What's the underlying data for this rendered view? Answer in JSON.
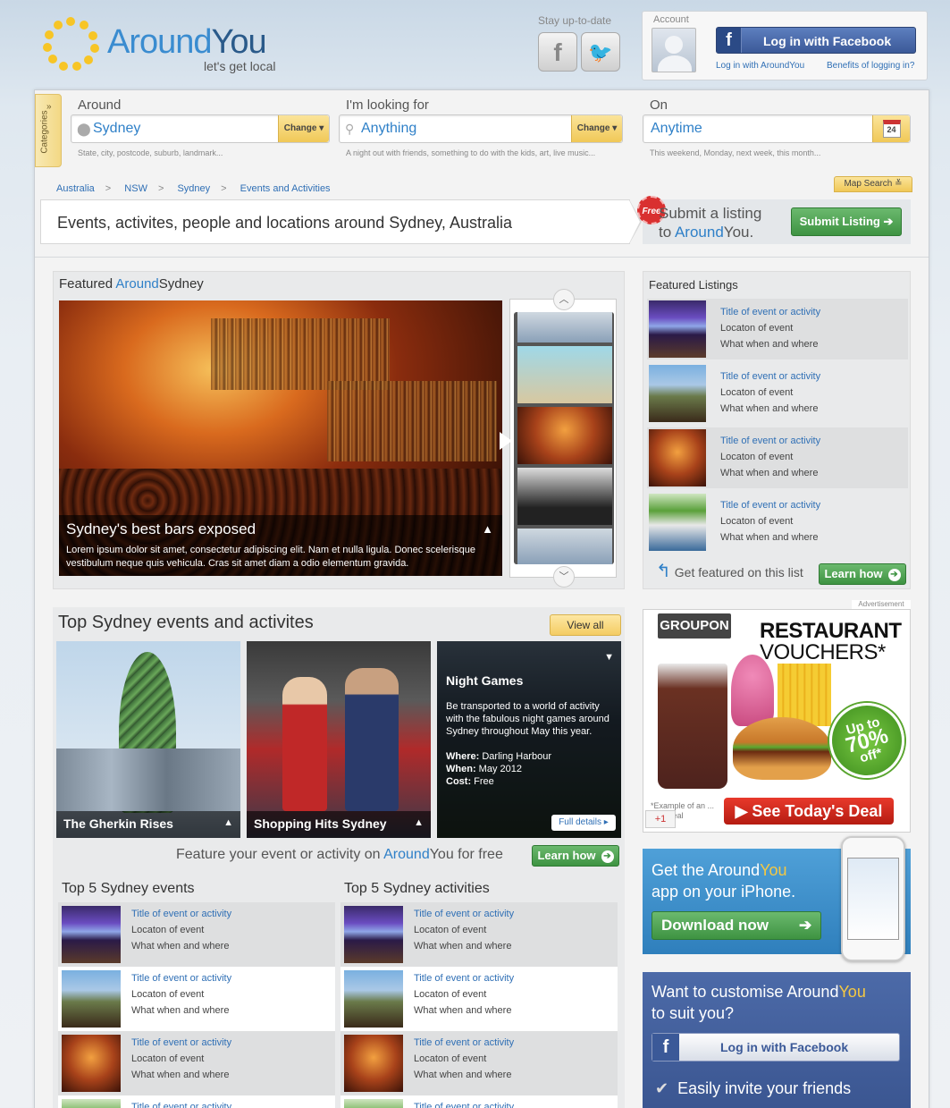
{
  "brand": {
    "name_part1": "Around",
    "name_part2": "You",
    "tagline": "let's get local"
  },
  "header": {
    "stay_label": "Stay up-to-date",
    "account_label": "Account",
    "fb_login": "Log in with Facebook",
    "aroundyou_login": "Log in with AroundYou",
    "benefits": "Benefits of logging in?"
  },
  "search": {
    "categories_tab": "Categories",
    "around": {
      "label": "Around",
      "value": "Sydney",
      "change": "Change",
      "hint": "State, city, postcode, suburb, landmark..."
    },
    "looking": {
      "label": "I'm looking for",
      "value": "Anything",
      "change": "Change",
      "hint": "A night out with friends, something to do with the kids, art, live music..."
    },
    "on": {
      "label": "On",
      "value": "Anytime",
      "hint": "This weekend, Monday, next week, this month...",
      "calendar_day": "24"
    }
  },
  "map_search": "Map Search",
  "breadcrumb": [
    "Australia",
    "NSW",
    "Sydney",
    "Events and Activities"
  ],
  "page_title": "Events, activites, people and locations around Sydney, Australia",
  "submit": {
    "badge": "Free",
    "line1": "Submit a listing",
    "line2_pre": "to ",
    "line2_brand_a": "Around",
    "line2_brand_b": "You.",
    "button": "Submit Listing"
  },
  "featured": {
    "title_pre": "Featured ",
    "title_brand": "Around",
    "title_post": "Sydney",
    "hero_title": "Sydney's best bars exposed",
    "hero_text": "Lorem ipsum dolor sit amet, consectetur adipiscing elit. Nam et nulla ligula. Donec scelerisque vestibulum neque quis vehicula. Cras sit amet diam a odio elementum gravida."
  },
  "featured_listings": {
    "title": "Featured Listings",
    "items": [
      {
        "title": "Title of event or activity",
        "location": "Locaton of event",
        "when": "What when and where"
      },
      {
        "title": "Title of event or activity",
        "location": "Locaton of event",
        "when": "What when and where"
      },
      {
        "title": "Title of event or activity",
        "location": "Locaton of event",
        "when": "What when and where"
      },
      {
        "title": "Title of event or activity",
        "location": "Locaton of event",
        "when": "What when and where"
      }
    ],
    "get_featured": "Get featured on this list",
    "learn": "Learn how"
  },
  "top": {
    "title": "Top Sydney events and activites",
    "view_all": "View all",
    "tiles": [
      {
        "caption": "The Gherkin Rises"
      },
      {
        "caption": "Shopping Hits Sydney"
      }
    ],
    "night": {
      "title": "Night Games",
      "text": "Be transported to a world of activity with the fabulous night games around Sydney throughout May this year.",
      "where_label": "Where:",
      "where": "Darling Harbour",
      "when_label": "When:",
      "when": "May 2012",
      "cost_label": "Cost:",
      "cost": "Free",
      "details": "Full details"
    },
    "feature_pre": "Feature your event or activity on ",
    "feature_brand_a": "Around",
    "feature_brand_b": "You",
    "feature_post": " for free",
    "learn": "Learn how"
  },
  "top5_events": {
    "title": "Top 5 Sydney events",
    "items": [
      {
        "title": "Title of event or activity",
        "location": "Locaton of event",
        "when": "What when and where"
      },
      {
        "title": "Title of event or activity",
        "location": "Locaton of event",
        "when": "What when and where"
      },
      {
        "title": "Title of event or activity",
        "location": "Locaton of event",
        "when": "What when and where"
      },
      {
        "title": "Title of event or activity",
        "location": "",
        "when": ""
      }
    ]
  },
  "top5_activities": {
    "title": "Top 5 Sydney activities",
    "items": [
      {
        "title": "Title of event or activity",
        "location": "Locaton of event",
        "when": "What when and where"
      },
      {
        "title": "Title of event or activity",
        "location": "Locaton of event",
        "when": "What when and where"
      },
      {
        "title": "Title of event or activity",
        "location": "Locaton of event",
        "when": "What when and where"
      },
      {
        "title": "Title of event or activity",
        "location": "",
        "when": ""
      }
    ]
  },
  "advert": {
    "label": "Advertisement",
    "groupon": "GROUPON",
    "h1": "RESTAURANT",
    "h2": "VOUCHERS*",
    "badge_top": "Up to",
    "badge_pct": "70%",
    "badge_bottom": "off*",
    "note": "*Example of an ... ning deal",
    "deal": "See Today's Deal",
    "gplus": "+1"
  },
  "iphone": {
    "line1_pre": "Get the ",
    "brand_a": "Around",
    "brand_b": "You",
    "line2": "app on your iPhone.",
    "button": "Download now"
  },
  "customise": {
    "line1_pre": "Want to customise ",
    "brand_a": "Around",
    "brand_b": "You",
    "line2": "to suit you?",
    "fb": "Log in with Facebook",
    "invite": "Easily invite your friends"
  },
  "colors": {
    "brand_blue": "#2f80c8",
    "accent_yellow": "#f0c857",
    "green": "#3e9342",
    "facebook": "#3b5998"
  }
}
